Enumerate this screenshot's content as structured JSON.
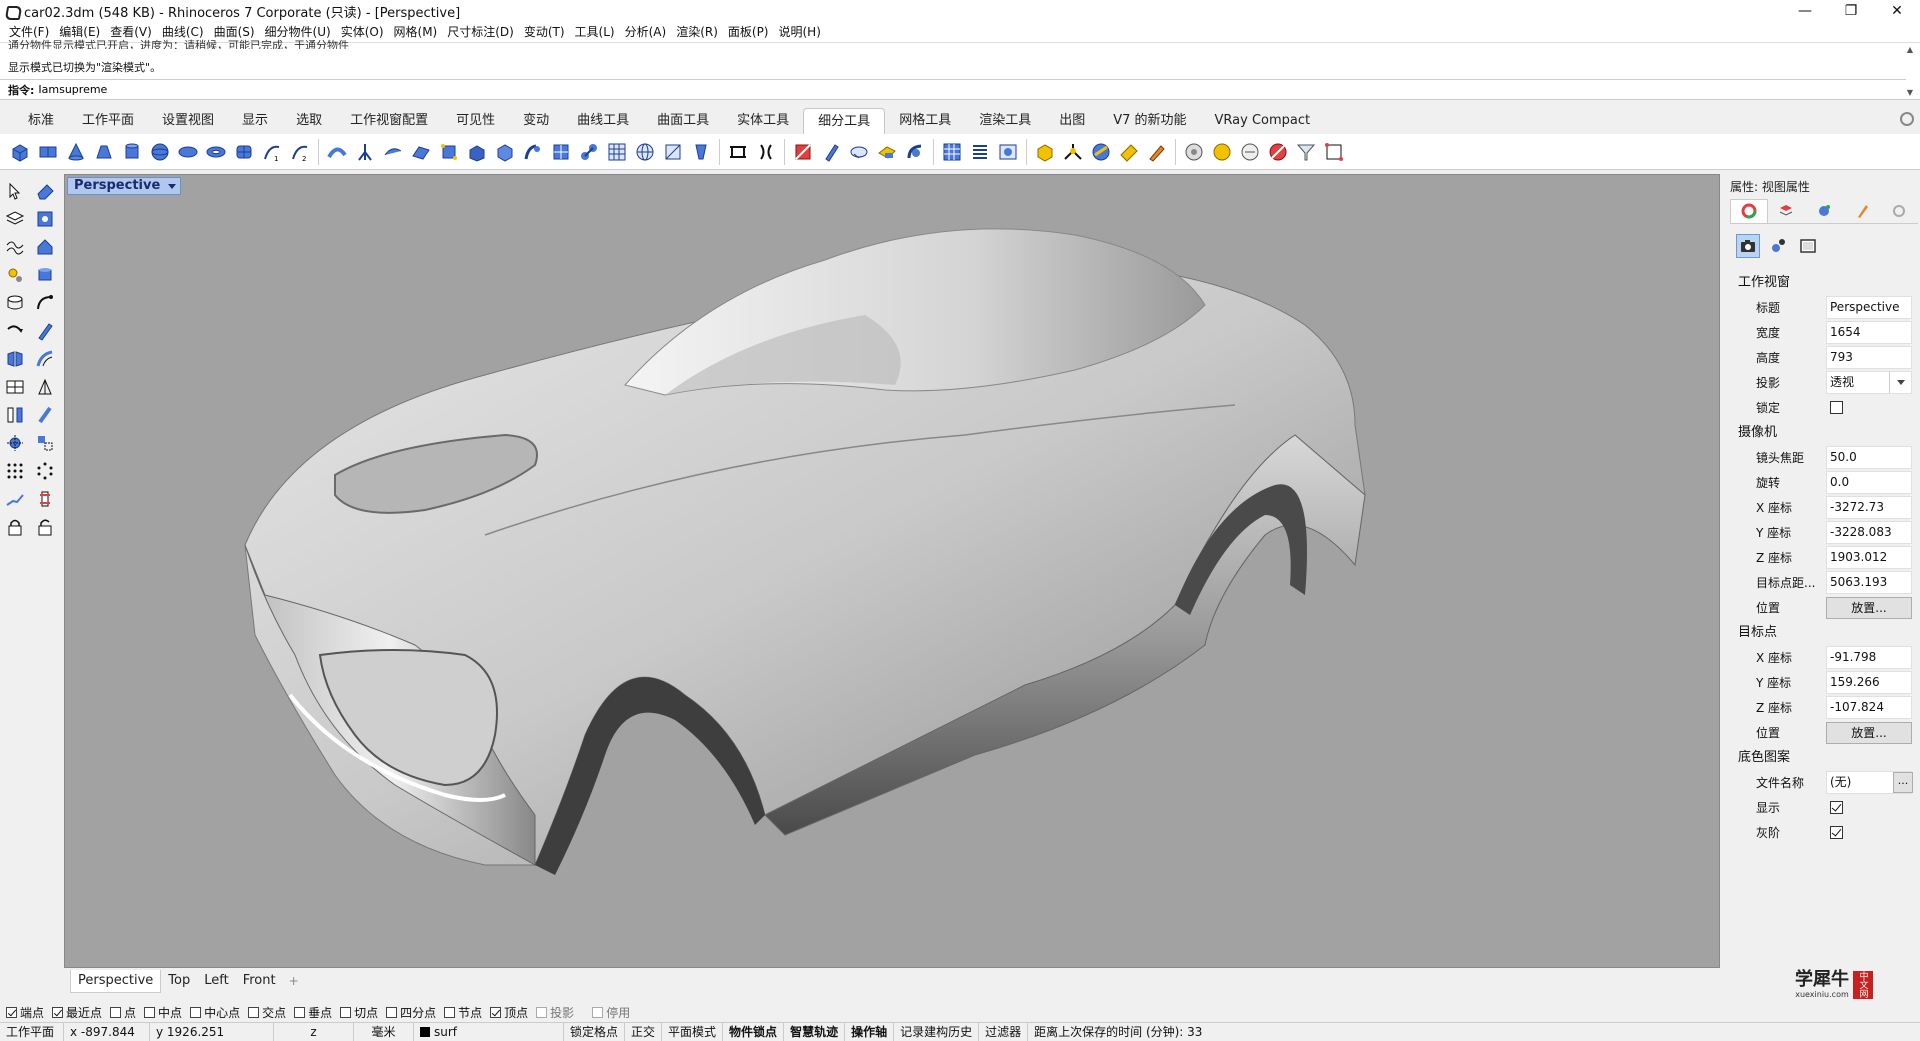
{
  "window": {
    "title": "car02.3dm (548 KB) - Rhinoceros 7 Corporate (只读) - [Perspective]",
    "minimize": "—",
    "maximize": "❐",
    "close": "✕"
  },
  "menu": [
    "文件(F)",
    "编辑(E)",
    "查看(V)",
    "曲线(C)",
    "曲面(S)",
    "细分物件(U)",
    "实体(O)",
    "网格(M)",
    "尺寸标注(D)",
    "变动(T)",
    "工具(L)",
    "分析(A)",
    "渲染(R)",
    "面板(P)",
    "说明(H)"
  ],
  "command": {
    "history_line1": "通分物件显示模式已开启，进度为：请稍候，可能已完成，于通分物件",
    "history_line2": "显示模式已切换为\"渲染模式\"。",
    "prompt_label": "指令:",
    "input_value": "Iamsupreme"
  },
  "tabs": [
    "标准",
    "工作平面",
    "设置视图",
    "显示",
    "选取",
    "工作视窗配置",
    "可见性",
    "变动",
    "曲线工具",
    "曲面工具",
    "实体工具",
    "细分工具",
    "网格工具",
    "渲染工具",
    "出图",
    "V7 的新功能",
    "VRay Compact"
  ],
  "active_tab": "细分工具",
  "viewport": {
    "label": "Perspective",
    "tabs": [
      "Perspective",
      "Top",
      "Left",
      "Front"
    ],
    "add": "+"
  },
  "osnap": [
    {
      "label": "端点",
      "checked": true
    },
    {
      "label": "最近点",
      "checked": true
    },
    {
      "label": "点",
      "checked": false
    },
    {
      "label": "中点",
      "checked": false
    },
    {
      "label": "中心点",
      "checked": false
    },
    {
      "label": "交点",
      "checked": false
    },
    {
      "label": "垂点",
      "checked": false
    },
    {
      "label": "切点",
      "checked": false
    },
    {
      "label": "四分点",
      "checked": false
    },
    {
      "label": "节点",
      "checked": false
    },
    {
      "label": "顶点",
      "checked": true
    },
    {
      "label": "投影",
      "checked": false,
      "disabled": true
    },
    {
      "label": "停用",
      "checked": false,
      "disabled": true
    }
  ],
  "status": {
    "cplane": "工作平面",
    "x": "x -897.844",
    "y": "y 1926.251",
    "z": "z",
    "units": "毫米",
    "layer": "surf",
    "grid_snap": "锁定格点",
    "ortho": "正交",
    "planar": "平面模式",
    "osnap": "物件锁点",
    "smarttrack": "智慧轨迹",
    "gumball": "操作轴",
    "history": "记录建构历史",
    "filter": "过滤器",
    "autosave": "距离上次保存的时间 (分钟): 33"
  },
  "panel": {
    "title": "属性: 视图属性",
    "viewport_section": "工作视窗",
    "title_label": "标题",
    "title_value": "Perspective",
    "width_label": "宽度",
    "width_value": "1654",
    "height_label": "高度",
    "height_value": "793",
    "projection_label": "投影",
    "projection_value": "透视",
    "locked_label": "锁定",
    "locked": false,
    "camera_section": "摄像机",
    "lens_label": "镜头焦距",
    "lens_value": "50.0",
    "rotation_label": "旋转",
    "rotation_value": "0.0",
    "cam_x_label": "X 座标",
    "cam_x_value": "-3272.73",
    "cam_y_label": "Y 座标",
    "cam_y_value": "-3228.083",
    "cam_z_label": "Z 座标",
    "cam_z_value": "1903.012",
    "target_dist_label": "目标点距...",
    "target_dist_value": "5063.193",
    "cam_pos_label": "位置",
    "place_button": "放置...",
    "target_section": "目标点",
    "tgt_x_label": "X 座标",
    "tgt_x_value": "-91.798",
    "tgt_y_label": "Y 座标",
    "tgt_y_value": "159.266",
    "tgt_z_label": "Z 座标",
    "tgt_z_value": "-107.824",
    "tgt_pos_label": "位置",
    "background_section": "底色图案",
    "filename_label": "文件名称",
    "filename_value": "(无)",
    "browse_button": "...",
    "show_label": "显示",
    "show_checked": true,
    "gray_label": "灰阶",
    "gray_checked": true
  },
  "watermark": {
    "text": "学犀牛",
    "sub": "xuexiniu.com",
    "seal": "中文网"
  }
}
